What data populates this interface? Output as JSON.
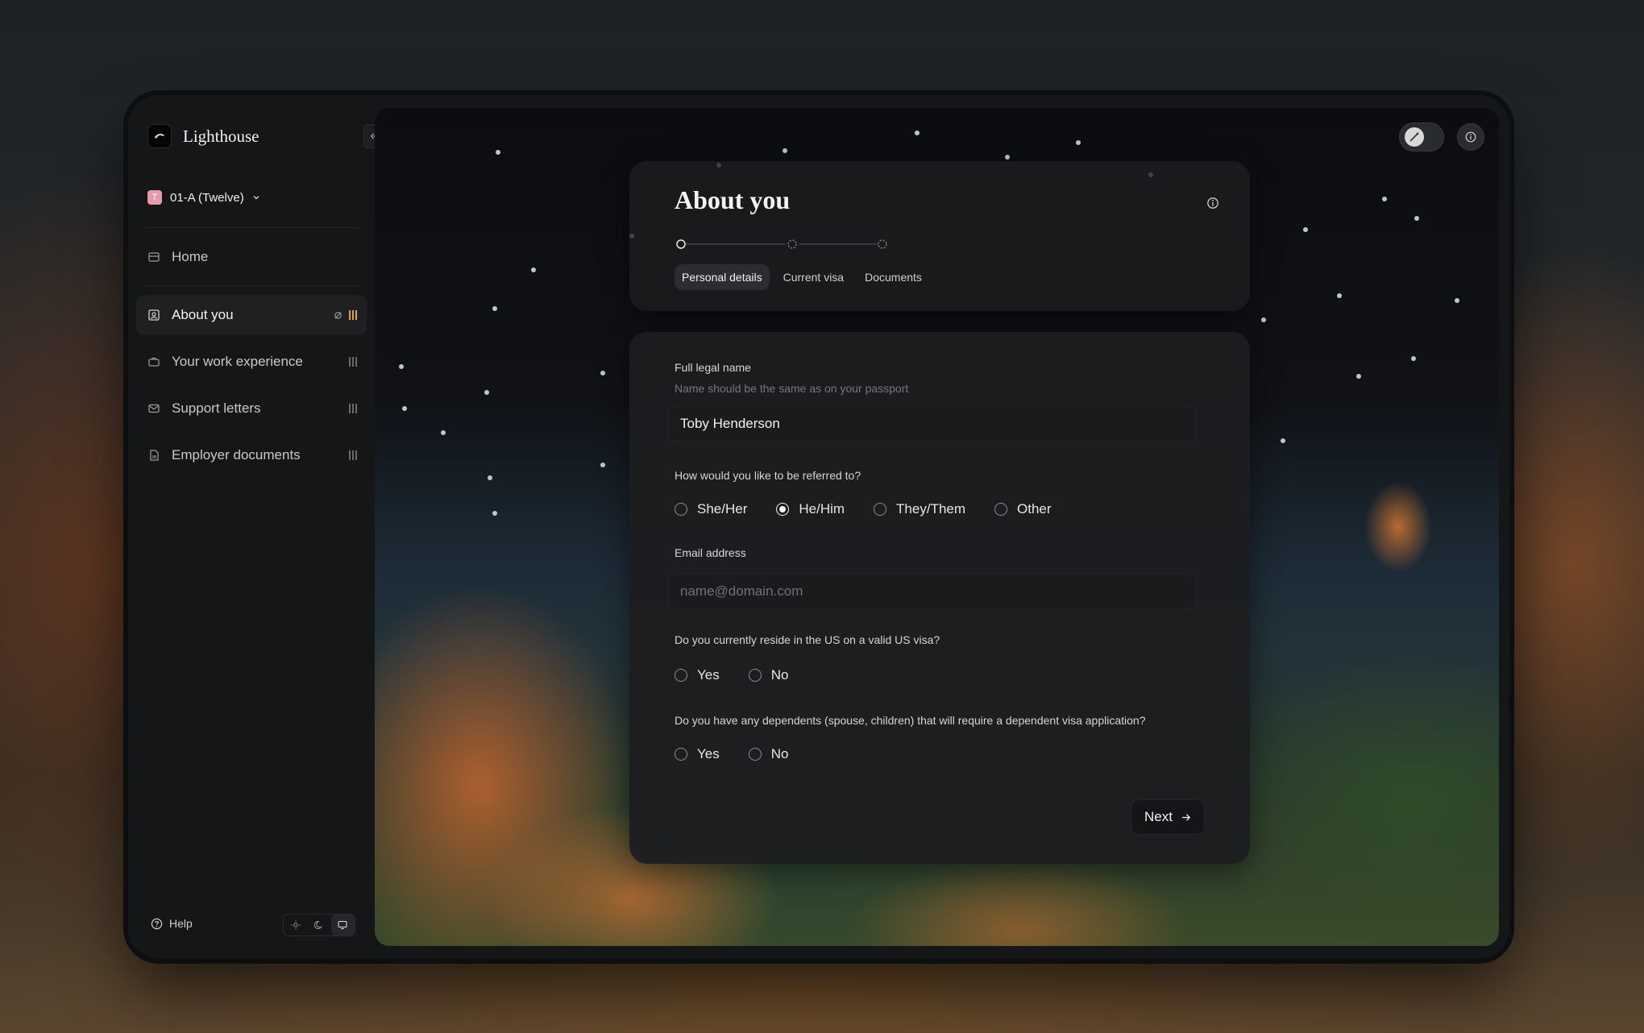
{
  "app": {
    "title": "Lighthouse"
  },
  "workspace": {
    "badge": "T",
    "label": "01-A (Twelve)"
  },
  "sidebar": {
    "items": [
      {
        "label": "Home"
      },
      {
        "label": "About you"
      },
      {
        "label": "Your work experience"
      },
      {
        "label": "Support letters"
      },
      {
        "label": "Employer documents"
      }
    ],
    "help_label": "Help"
  },
  "header": {
    "title": "About you",
    "tabs": [
      {
        "label": "Personal details"
      },
      {
        "label": "Current visa"
      },
      {
        "label": "Documents"
      }
    ]
  },
  "form": {
    "name_label": "Full legal name",
    "name_hint": "Name should be the same as on your passport",
    "name_value": "Toby Henderson",
    "pronoun_label": "How would you like to be referred to?",
    "pronoun_options": [
      {
        "label": "She/Her",
        "checked": false
      },
      {
        "label": "He/Him",
        "checked": true
      },
      {
        "label": "They/Them",
        "checked": false
      },
      {
        "label": "Other",
        "checked": false
      }
    ],
    "email_label": "Email address",
    "email_placeholder": "name@domain.com",
    "visa_label": "Do you currently reside in the US on a valid US visa?",
    "visa_options": [
      {
        "label": "Yes"
      },
      {
        "label": "No"
      }
    ],
    "dependents_label": "Do you have any dependents (spouse, children) that will require a dependent visa application?",
    "dependents_options": [
      {
        "label": "Yes"
      },
      {
        "label": "No"
      }
    ],
    "next_label": "Next"
  },
  "colors": {
    "accent_progress": "#e6a32a",
    "workspace_badge": "#e79aab"
  }
}
